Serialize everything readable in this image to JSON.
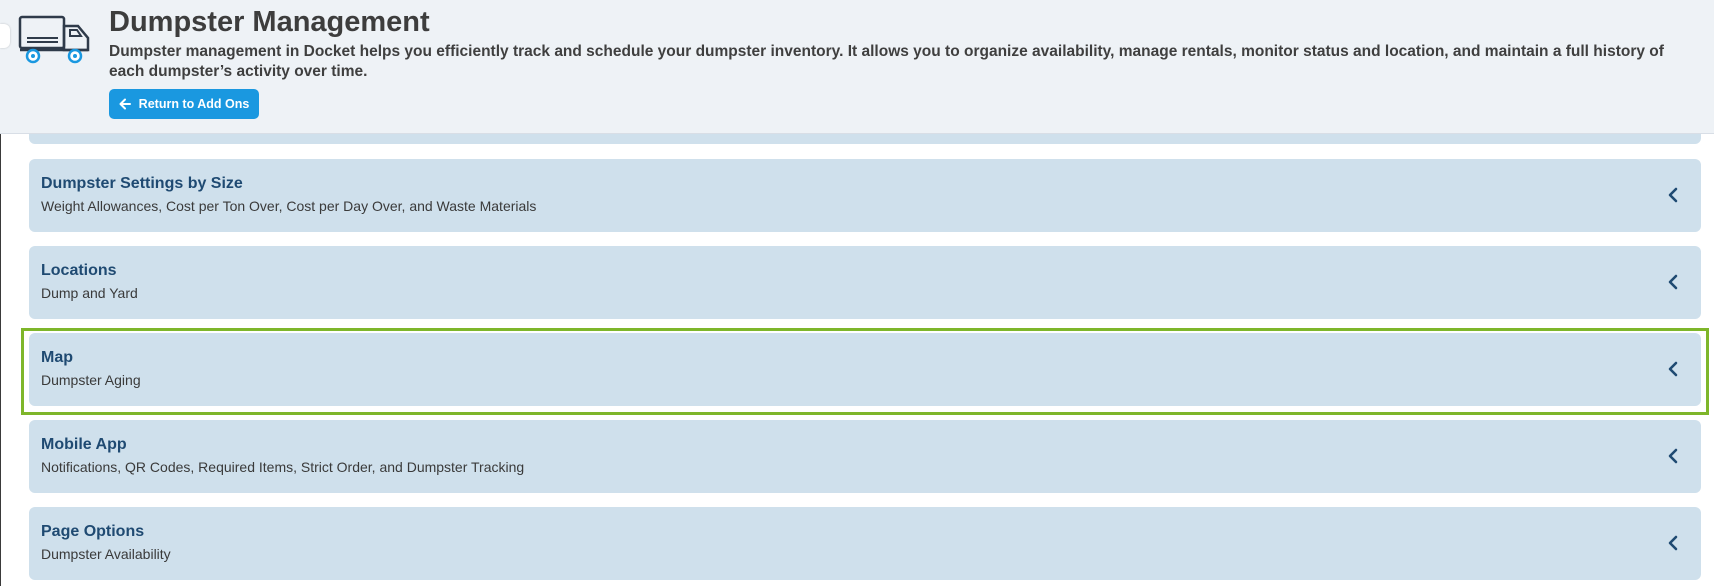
{
  "header": {
    "title": "Dumpster Management",
    "description": "Dumpster management in Docket helps you efficiently track and schedule your dumpster inventory. It allows you to organize availability, manage rentals, monitor status and location, and maintain a full history of each dumpster’s activity over time.",
    "return_button_label": "Return to Add Ons",
    "icon": "truck-icon"
  },
  "cards": [
    {
      "title": "Dumpster Settings by Size",
      "subtitle": "Weight Allowances, Cost per Ton Over, Cost per Day Over, and Waste Materials"
    },
    {
      "title": "Locations",
      "subtitle": "Dump and Yard"
    },
    {
      "title": "Map",
      "subtitle": "Dumpster Aging"
    },
    {
      "title": "Mobile App",
      "subtitle": "Notifications, QR Codes, Required Items, Strict Order, and Dumpster Tracking"
    },
    {
      "title": "Page Options",
      "subtitle": "Dumpster Availability"
    }
  ],
  "colors": {
    "accent": "#1a98e0",
    "card_background": "#cfe0ec",
    "card_title": "#1f4a72",
    "highlight": "#7eb62a"
  }
}
